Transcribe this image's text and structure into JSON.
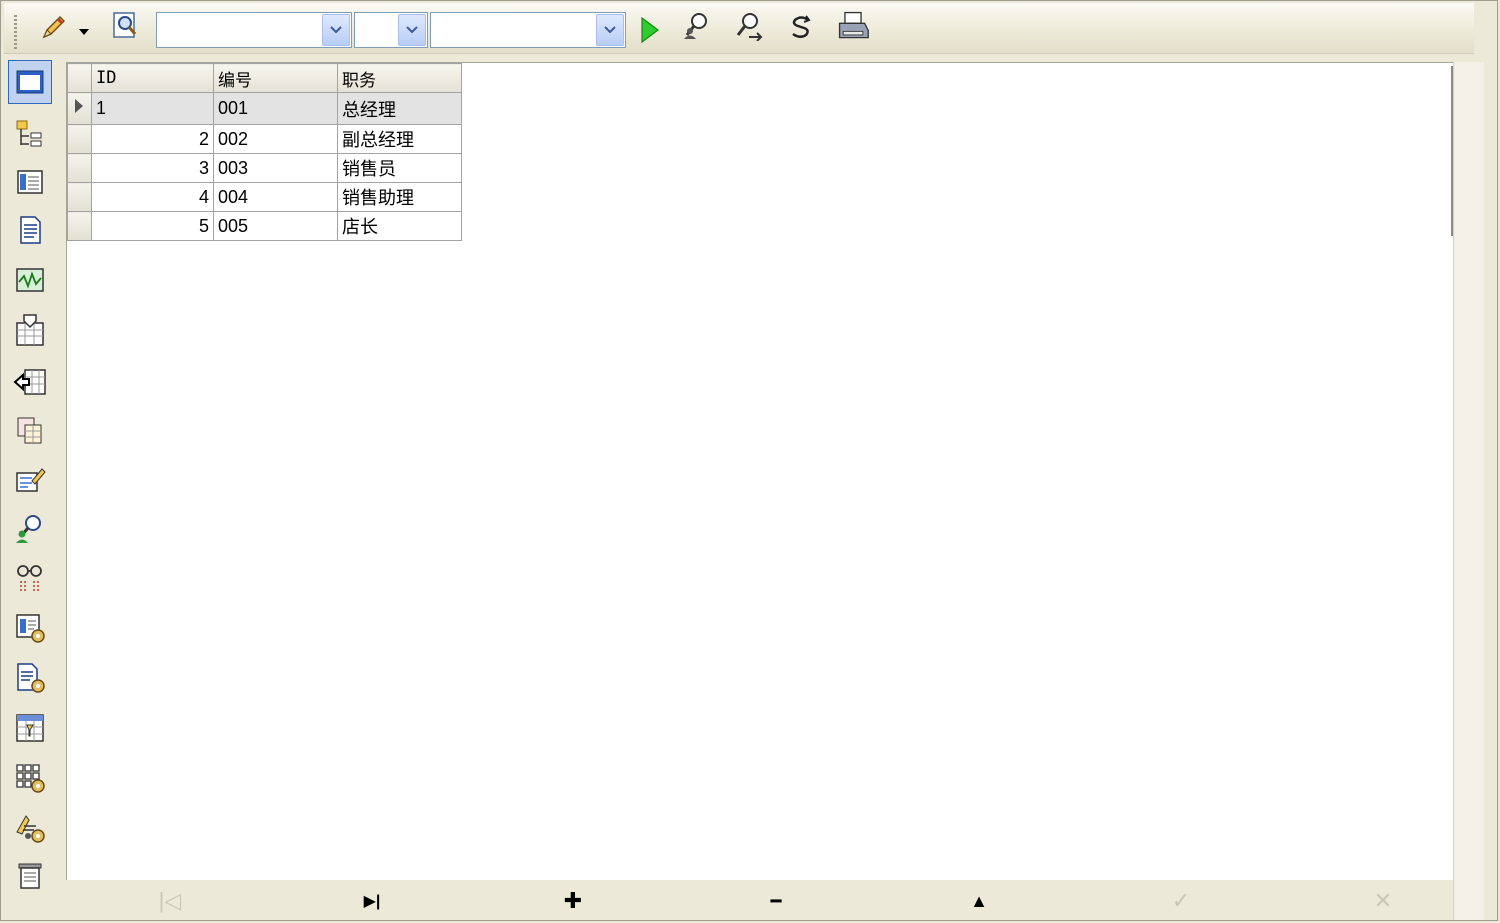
{
  "toolbar": {
    "icons": [
      "pencil-edit-icon",
      "dropdown-arrow-icon",
      "magnifier-page-icon",
      "run-play-icon",
      "find-user-icon",
      "find-next-user-icon",
      "refresh-s-icon",
      "print-icon"
    ],
    "combo1_value": "",
    "combo2_value": "",
    "combo3_value": ""
  },
  "sidebar": {
    "icons": [
      "window-view-icon",
      "tree-hierarchy-icon",
      "list-form-icon",
      "document-icon",
      "chart-waveform-icon",
      "calendar-export-icon",
      "import-grid-icon",
      "grid-multi-icon",
      "edit-form-icon",
      "user-search-icon",
      "lookup-glasses-icon",
      "form-settings-icon",
      "document-settings-icon",
      "grid-filter-icon",
      "grid-table-settings-icon",
      "user-settings-icon",
      "report-printer-icon"
    ]
  },
  "grid": {
    "columns": [
      "ID",
      "编号",
      "职务"
    ],
    "rows": [
      {
        "id": "1",
        "code": "001",
        "title": "总经理"
      },
      {
        "id": "2",
        "code": "002",
        "title": "副总经理"
      },
      {
        "id": "3",
        "code": "003",
        "title": "销售员"
      },
      {
        "id": "4",
        "code": "004",
        "title": "销售助理"
      },
      {
        "id": "5",
        "code": "005",
        "title": "店长"
      }
    ],
    "selected_row": 0
  },
  "navigator": {
    "buttons": [
      {
        "name": "first-record-icon",
        "glyph": "|◁",
        "enabled": false
      },
      {
        "name": "last-record-icon",
        "glyph": "▶|",
        "enabled": true
      },
      {
        "name": "insert-record-icon",
        "glyph": "✚",
        "enabled": true
      },
      {
        "name": "delete-record-icon",
        "glyph": "━",
        "enabled": true
      },
      {
        "name": "edit-record-icon",
        "glyph": "▲",
        "enabled": true
      },
      {
        "name": "post-record-icon",
        "glyph": "✓",
        "enabled": false
      },
      {
        "name": "cancel-record-icon",
        "glyph": "✕",
        "enabled": false
      }
    ]
  }
}
